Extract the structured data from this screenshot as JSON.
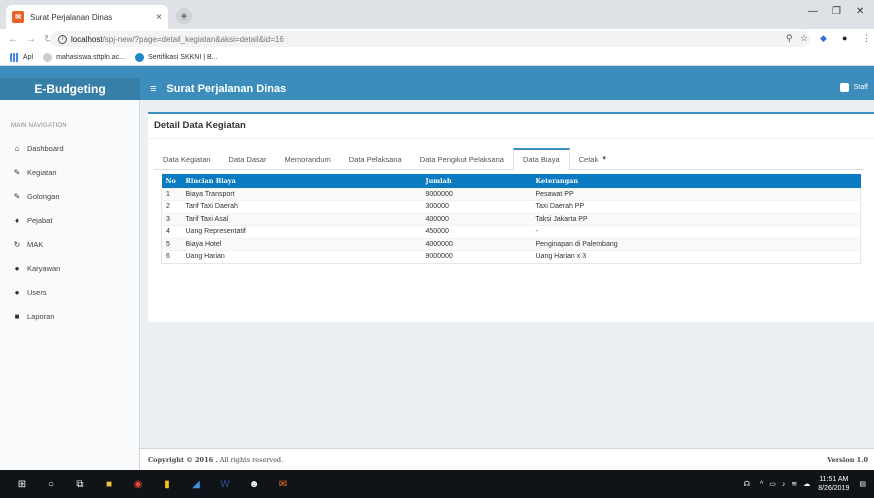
{
  "browser": {
    "tab_title": "Surat Perjalanan Dinas",
    "tab_close": "×",
    "new_tab": "+",
    "url_host": "localhost",
    "url_path": "/spj-new/?page=detail_kegiatan&aksi=detail&id=16",
    "bookmarks": [
      {
        "label": "Apl",
        "icon": "apps-grid-icon"
      },
      {
        "label": "mahasiswa.sttpln.ac...",
        "icon": "globe-icon"
      },
      {
        "label": "Sertifikasi SKKNI | B...",
        "icon": "edge-icon"
      }
    ]
  },
  "app": {
    "logo": "E-Budgeting",
    "page_title": "Surat Perjalanan Dinas",
    "user": "Staff",
    "accent": "#3c8dbc"
  },
  "sidebar": {
    "header": "MAIN NAVIGATION",
    "items": [
      {
        "label": "Dashboard",
        "icon": "home-icon"
      },
      {
        "label": "Kegiatan",
        "icon": "edit-icon"
      },
      {
        "label": "Golongan",
        "icon": "edit-icon"
      },
      {
        "label": "Pejabat",
        "icon": "thumbs-up-icon"
      },
      {
        "label": "MAK",
        "icon": "refresh-icon"
      },
      {
        "label": "Karyawan",
        "icon": "users-icon"
      },
      {
        "label": "Users",
        "icon": "users-icon"
      },
      {
        "label": "Laporan",
        "icon": "folder-icon"
      }
    ]
  },
  "main": {
    "box_title": "Detail Data Kegiatan",
    "tabs": [
      {
        "label": "Data Kegiatan"
      },
      {
        "label": "Data Dasar"
      },
      {
        "label": "Memorandum"
      },
      {
        "label": "Data Pelaksana"
      },
      {
        "label": "Data Pengikut Pelaksana"
      },
      {
        "label": "Data Biaya"
      },
      {
        "label": "Cetak"
      }
    ],
    "active_tab": "Data Biaya",
    "table": {
      "headers": [
        "No",
        "Rincian Biaya",
        "Jumlah",
        "Keterangan"
      ],
      "rows": [
        [
          "1",
          "Biaya Transport",
          "9000000",
          "Pesawat PP"
        ],
        [
          "2",
          "Tarif Taxi Daerah",
          "300000",
          "Taxi Daerah PP"
        ],
        [
          "3",
          "Tarif Taxi Asal",
          "400000",
          "Taksi Jakarta PP"
        ],
        [
          "4",
          "Uang Representatif",
          "450000",
          "-"
        ],
        [
          "5",
          "Biaya Hotel",
          "4000000",
          "Penginapan di Palembang"
        ],
        [
          "6",
          "Uang Harian",
          "9000000",
          "Uang Harian x 3"
        ]
      ]
    }
  },
  "footer": {
    "copyright_bold": "Copyright © 2016 .",
    "copyright_rest": " All rights reserved.",
    "version": "Version 1.0"
  },
  "taskbar": {
    "time": "11:51 AM",
    "date": "8/26/2019"
  }
}
